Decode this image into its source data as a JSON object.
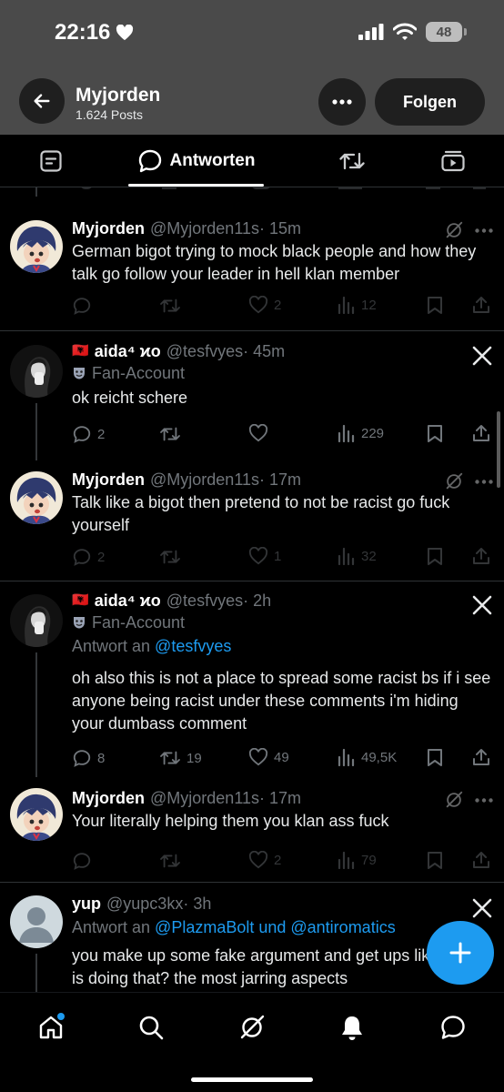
{
  "status": {
    "time": "22:16",
    "battery": "48"
  },
  "header": {
    "name": "Myjorden",
    "posts": "1.624 Posts",
    "follow_label": "Folgen"
  },
  "tabs": {
    "active_label": "Antworten"
  },
  "posts": [
    {
      "name": "Myjorden",
      "handle": "@Myjorden11s",
      "time": "· 15m",
      "text": "German bigot trying to mock black people and how they talk go follow your leader in hell klan member",
      "replies": "",
      "reposts": "",
      "likes": "2",
      "views": "12"
    },
    {
      "flag": "🇦🇱",
      "name": "aida⁴ ϰo",
      "handle": "@tesfvyes",
      "time": "· 45m",
      "sub": "Fan-Account",
      "text": "ok reicht schere",
      "replies": "2",
      "reposts": "",
      "likes": "",
      "views": "229"
    },
    {
      "name": "Myjorden",
      "handle": "@Myjorden11s",
      "time": "· 17m",
      "text": "Talk like a bigot then pretend to not be racist go fuck yourself",
      "replies": "2",
      "reposts": "",
      "likes": "1",
      "views": "32"
    },
    {
      "flag": "🇦🇱",
      "name": "aida⁴ ϰo",
      "handle": "@tesfvyes",
      "time": "· 2h",
      "sub": "Fan-Account",
      "reply_prefix": "Antwort an ",
      "reply_to": "@tesfvyes",
      "text": "oh also this is not a place to spread some racist bs if i see anyone being racist under these comments i'm hiding your dumbass comment",
      "replies": "8",
      "reposts": "19",
      "likes": "49",
      "views": "49,5K"
    },
    {
      "name": "Myjorden",
      "handle": "@Myjorden11s",
      "time": "· 17m",
      "text": "Your literally helping them you klan ass fuck",
      "replies": "",
      "reposts": "",
      "likes": "2",
      "views": "79"
    },
    {
      "name": "yup",
      "handle": "@yupc3kx",
      "time": "· 3h",
      "reply_prefix": "Antwort an ",
      "reply_to": "@PlazmaBolt und @antiromatics",
      "text": "you make up some fake argument and get ups like who tf is doing that? the most jarring aspects"
    }
  ],
  "colors": {
    "accent": "#1d9bf0",
    "muted": "#71767b",
    "header_bg": "#4a4a4a"
  },
  "icons": {
    "tabs": [
      "article-icon",
      "speech-bubble-icon",
      "repost-icon",
      "video-icon"
    ],
    "nav": [
      "home-icon",
      "search-icon",
      "grok-icon",
      "bell-icon",
      "chat-icon"
    ]
  }
}
